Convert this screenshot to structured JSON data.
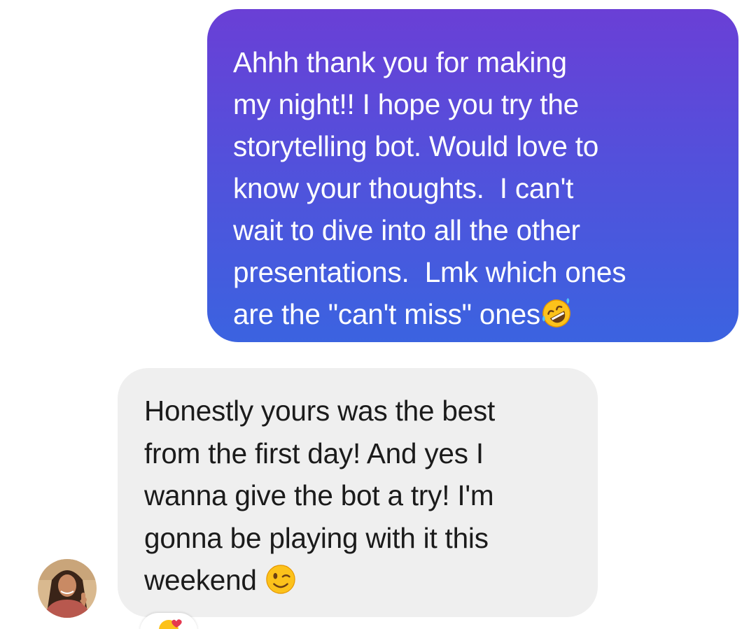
{
  "conversation": {
    "outgoing": {
      "lines": [
        "Ahhh thank you for making",
        "my night!! I hope you try the",
        "storytelling bot. Would love to",
        "know your thoughts.  I can't",
        "wait to dive into all the other",
        "presentations.  Lmk which ones",
        "are the \"can't miss\" ones"
      ],
      "end_emoji": "rolling-on-floor-laughing-emoji"
    },
    "incoming": {
      "lines": [
        "Honestly yours was the best",
        "from the first day! And yes I",
        "wanna give the bot a try! I'm",
        "gonna be playing with it this",
        "weekend "
      ],
      "end_emoji": "winking-face-emoji",
      "reaction_emoji": "heart-eyes-reaction-emoji"
    }
  },
  "colors": {
    "outgoing_gradient_top": "#6a3fd6",
    "outgoing_gradient_bottom": "#3b63e0",
    "incoming_bubble": "#efefef",
    "incoming_text": "#1b1b1b"
  }
}
